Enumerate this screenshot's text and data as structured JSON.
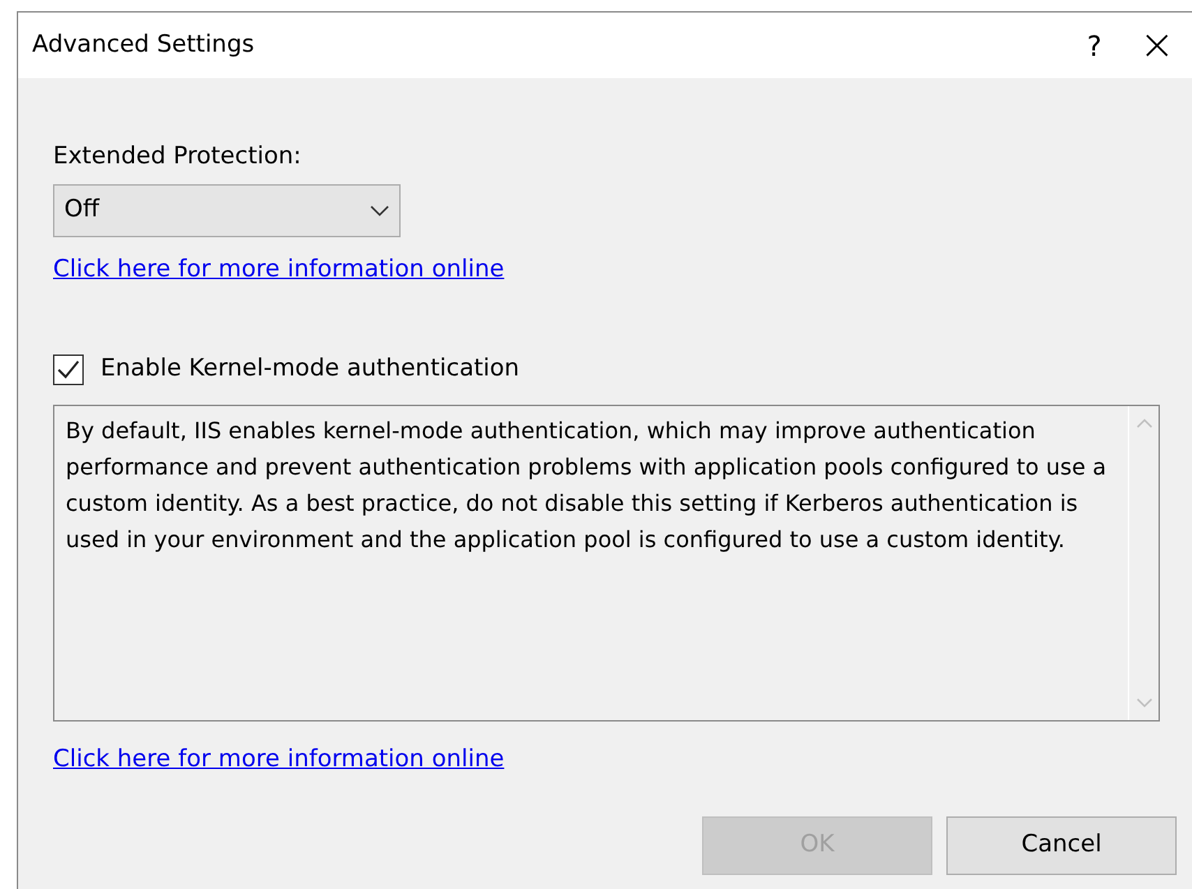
{
  "window": {
    "title": "Advanced Settings",
    "help": "?",
    "close": "×"
  },
  "extended_protection": {
    "label": "Extended Protection:",
    "value": "Off"
  },
  "link_1": "Click here for more information online",
  "kernel_mode": {
    "label": "Enable Kernel-mode authentication",
    "checked": true
  },
  "description": "By default, IIS enables kernel-mode authentication, which may improve authentication performance and prevent authentication problems with application pools configured to use a custom identity. As a best practice, do not disable this setting if Kerberos authentication is used in your environment and the application pool is configured to use a custom identity.",
  "link_2": "Click here for more information online",
  "buttons": [
    {
      "label": "OK",
      "disabled": true
    },
    {
      "label": "Cancel",
      "disabled": false
    }
  ]
}
